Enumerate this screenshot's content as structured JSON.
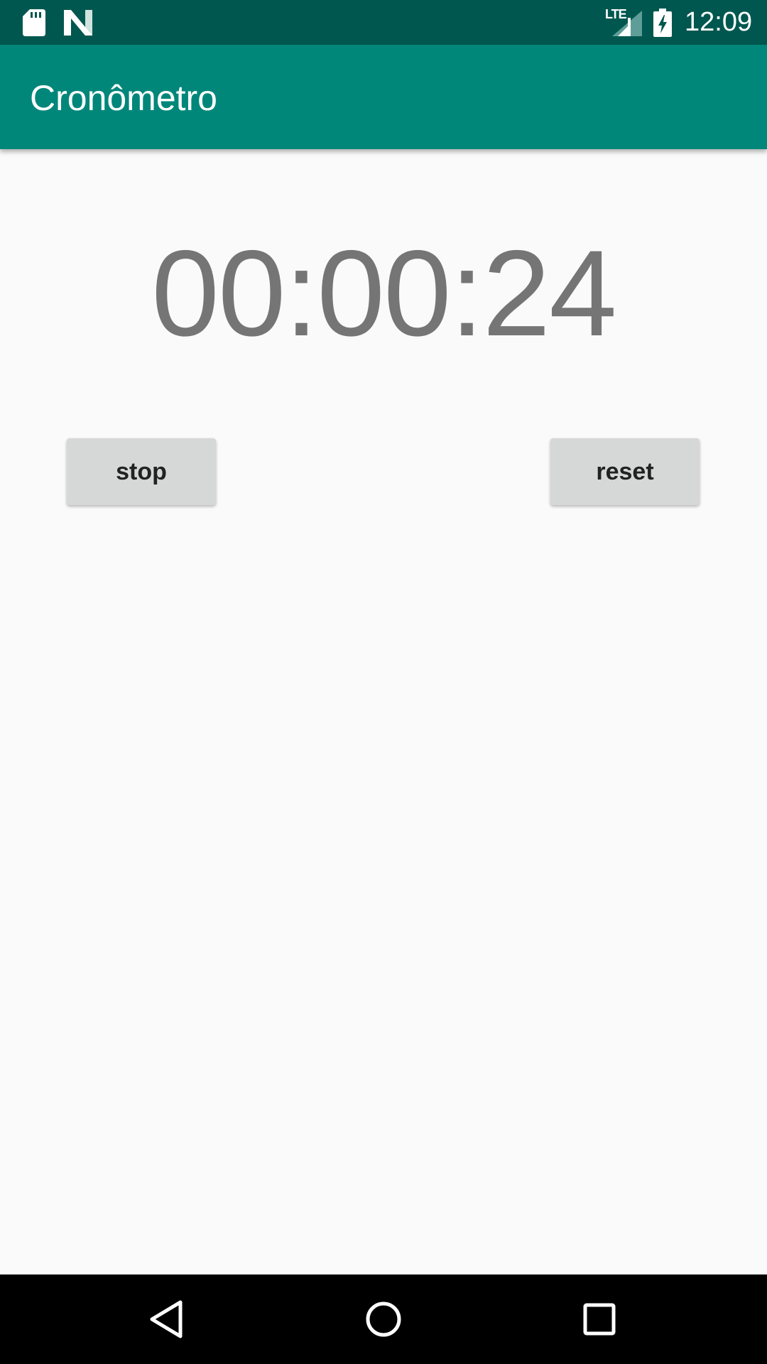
{
  "status_bar": {
    "time": "12:09",
    "network_label": "LTE",
    "icons": [
      "sd-card-icon",
      "n-notification-icon",
      "lte-signal-icon",
      "battery-charging-icon"
    ]
  },
  "app_bar": {
    "title": "Cronômetro"
  },
  "stopwatch": {
    "display": "00:00:24"
  },
  "controls": {
    "stop_label": "stop",
    "reset_label": "reset"
  },
  "nav_bar": {
    "icons": [
      "back-icon",
      "home-icon",
      "recents-icon"
    ]
  },
  "colors": {
    "status_bar": "#00574f",
    "app_bar": "#00877a",
    "background": "#fafafa",
    "timer_text": "#757575",
    "button_bg": "#d6d7d7",
    "button_text": "#222222",
    "nav_bar": "#000000"
  }
}
